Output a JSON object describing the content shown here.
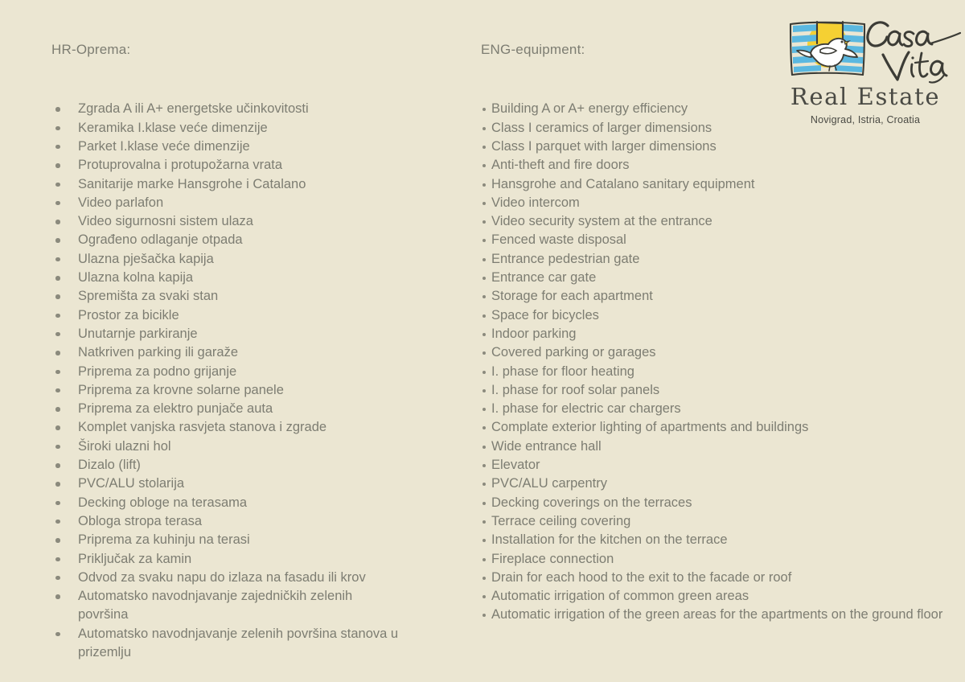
{
  "background_color": "#ebe6d2",
  "text_color": "#7d7d72",
  "columns": {
    "croatian": {
      "title": "HR-Oprema:",
      "items": [
        "Zgrada A ili A+ energetske učinkovitosti",
        "Keramika I.klase veće dimenzije",
        "Parket I.klase veće dimenzije",
        "Protuprovalna i protupožarna vrata",
        "Sanitarije marke Hansgrohe i Catalano",
        "Video parlafon",
        "Video sigurnosni sistem ulaza",
        "Ograđeno odlaganje otpada",
        "Ulazna pješačka kapija",
        "Ulazna kolna kapija",
        "Spremišta za svaki stan",
        "Prostor za bicikle",
        "Unutarnje parkiranje",
        "Natkriven parking ili garaže",
        "Priprema za podno grijanje",
        "Priprema za krovne solarne panele",
        "Priprema za elektro punjače auta",
        "Komplet vanjska rasvjeta stanova i zgrade",
        "Široki ulazni hol",
        "Dizalo (lift)",
        "PVC/ALU stolarija",
        "Decking obloge na terasama",
        "Obloga stropa terasa",
        "Priprema za kuhinju na terasi",
        "Priključak za kamin",
        "Odvod za svaku napu do izlaza na fasadu ili krov",
        "Automatsko navodnjavanje zajedničkih zelenih površina",
        "Automatsko navodnjavanje zelenih površina stanova u prizemlju"
      ]
    },
    "english": {
      "title": "ENG-equipment:",
      "items": [
        "Building A or A+ energy efficiency",
        "Class I ceramics of larger dimensions",
        "Class I parquet with larger dimensions",
        "Anti-theft and fire doors",
        "Hansgrohe and Catalano sanitary equipment",
        "Video intercom",
        "Video security system at the entrance",
        "Fenced waste disposal",
        "Entrance pedestrian gate",
        "Entrance car gate",
        "Storage for each apartment",
        "Space for bicycles",
        "Indoor parking",
        "Covered parking or garages",
        "I. phase for floor heating",
        "I. phase for roof solar panels",
        "I. phase for electric car chargers",
        "Complate exterior lighting of apartments and buildings",
        "Wide entrance hall",
        "Elevator",
        "PVC/ALU carpentry",
        "Decking coverings on the terraces",
        "Terrace ceiling covering",
        "Installation for the kitchen on the terrace",
        "Fireplace connection",
        "Drain for each hood to the exit to the facade or roof",
        "Automatic irrigation of common green areas",
        "Automatic irrigation of the green areas for the apartments on the ground floor"
      ]
    }
  },
  "logo": {
    "brand_script": "Casa Vita",
    "tagline": "Real Estate",
    "location": "Novigrad, Istria, Croatia",
    "mark_description": "dove-over-sun-with-stripes",
    "colors": {
      "stripes_blue": "#5bb8e0",
      "sun_yellow": "#f5d033",
      "dove_white": "#ffffff",
      "ink": "#3c3c36"
    }
  }
}
